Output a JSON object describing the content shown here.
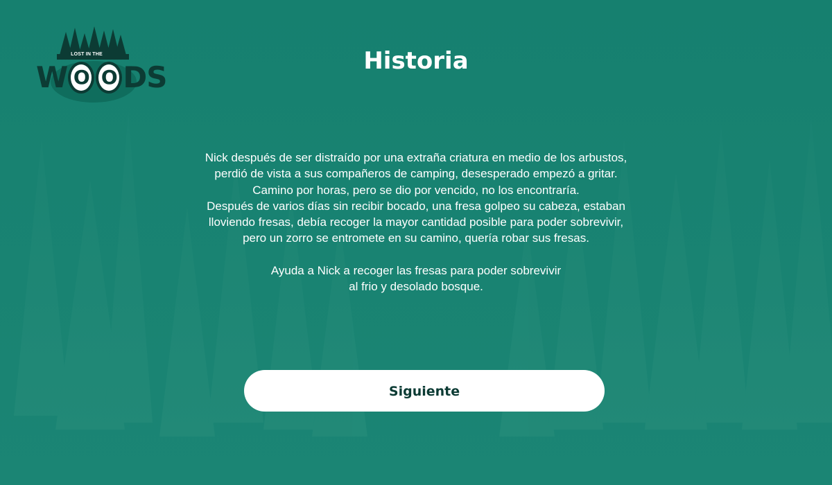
{
  "logo": {
    "tagline": "LOST IN THE",
    "word_start": "W",
    "word_o1": "O",
    "word_o2": "O",
    "word_end": "DS"
  },
  "screen": {
    "title": "Historia",
    "story_lines": [
      "Nick después de ser distraído por una extraña criatura en medio de los arbustos,",
      "perdió de vista a sus compañeros de camping, desesperado empezó a gritar.",
      "Camino por horas, pero se dio por vencido, no los encontraría.",
      "Después de varios días sin recibir bocado, una fresa golpeo su cabeza, estaban",
      "lloviendo fresas, debía recoger la mayor cantidad posible para poder sobrevivir,",
      "pero un zorro se entromete en su camino, quería robar sus fresas."
    ],
    "call_to_action_lines": [
      "Ayuda a Nick a recoger las fresas para poder sobrevivir",
      "al frio y desolado bosque."
    ],
    "next_button_label": "Siguiente"
  },
  "colors": {
    "background": "#16806f",
    "logo_dark": "#0c3b34",
    "text": "#ffffff",
    "button_bg": "#ffffff",
    "button_text": "#0c3b34"
  }
}
